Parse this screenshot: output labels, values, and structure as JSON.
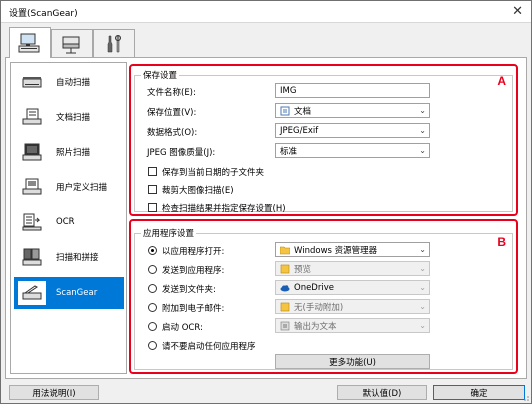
{
  "window": {
    "title": "设置(ScanGear)",
    "close_glyph": "✕"
  },
  "tabs": [
    {
      "icon": "computer-scanner-icon",
      "active": true
    },
    {
      "icon": "network-scanner-icon",
      "active": false
    },
    {
      "icon": "tools-icon",
      "active": false
    }
  ],
  "sidebar": {
    "items": [
      {
        "label": "自动扫描",
        "icon": "auto-scan-icon"
      },
      {
        "label": "文档扫描",
        "icon": "document-scan-icon"
      },
      {
        "label": "照片扫描",
        "icon": "photo-scan-icon"
      },
      {
        "label": "用户定义扫描",
        "icon": "custom-scan-icon"
      },
      {
        "label": "OCR",
        "icon": "ocr-icon"
      },
      {
        "label": "扫描和拼接",
        "icon": "scan-stitch-icon"
      },
      {
        "label": "ScanGear",
        "icon": "scangear-icon",
        "selected": true
      }
    ]
  },
  "save_settings": {
    "group_title": "保存设置",
    "marker": "A",
    "file_name_label": "文件名称(E):",
    "file_name_value": "IMG",
    "save_in_label": "保存位置(V):",
    "save_in_value": "文档",
    "data_format_label": "数据格式(O):",
    "data_format_value": "JPEG/Exif",
    "jpeg_quality_label": "JPEG 图像质量(J):",
    "jpeg_quality_value": "标准",
    "checkboxes": [
      {
        "label": "保存到当前日期的子文件夹",
        "checked": false
      },
      {
        "label": "裁剪大图像扫描(E)",
        "checked": false
      },
      {
        "label": "检查扫描结果并指定保存设置(H)",
        "checked": false
      }
    ]
  },
  "app_settings": {
    "group_title": "应用程序设置",
    "marker": "B",
    "options": [
      {
        "label": "以应用程序打开:",
        "value": "Windows 资源管理器",
        "icon": "folder-explorer-icon",
        "selected": true,
        "enabled": true
      },
      {
        "label": "发送到应用程序:",
        "value": "预览",
        "icon": "preview-icon",
        "selected": false,
        "enabled": false
      },
      {
        "label": "发送到文件夹:",
        "value": "OneDrive",
        "icon": "cloud-icon",
        "selected": false,
        "enabled": false
      },
      {
        "label": "附加到电子邮件:",
        "value": "无(手动附加)",
        "icon": "mail-folder-icon",
        "selected": false,
        "enabled": false
      },
      {
        "label": "启动 OCR:",
        "value": "输出为文本",
        "icon": "text-icon",
        "selected": false,
        "enabled": false
      },
      {
        "label": "请不要启动任何应用程序",
        "selected": false
      }
    ],
    "more_functions_label": "更多功能(U)"
  },
  "footer": {
    "help_label": "用法说明(I)",
    "defaults_label": "默认值(D)",
    "ok_label": "确定"
  }
}
